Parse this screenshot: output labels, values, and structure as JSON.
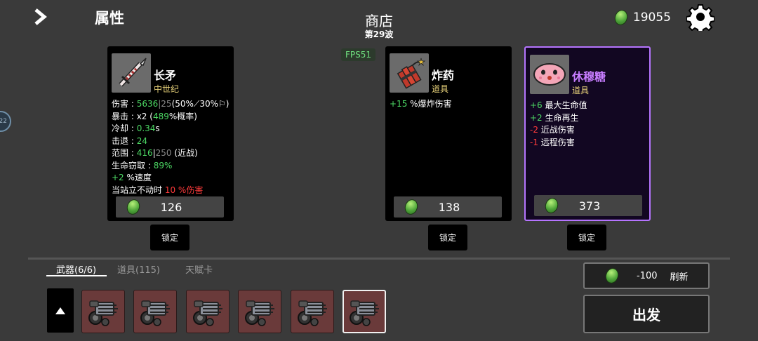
{
  "header": {
    "page_heading": "属性",
    "shop_title": "商店",
    "wave": "第29波",
    "currency_amount": "19055",
    "fps": "FPS51"
  },
  "cards": [
    {
      "name": "长矛",
      "type": "中世纪",
      "name_color": "#ffffff",
      "stats": {
        "damage_label": "伤害 : ",
        "damage_val": "5636",
        "damage_base": "25",
        "damage_scaling": "(50%⟋30%⚐)",
        "crit_label": "暴击 : ",
        "crit_mult": "x2",
        "crit_open": " (",
        "crit_chance": "489",
        "crit_suffix": "%概率)",
        "cooldown_label": "冷却 : ",
        "cooldown_val": "0.34",
        "cooldown_unit": "s",
        "knockback_label": "击退 : ",
        "knockback_val": "24",
        "range_label": "范围 : ",
        "range_val": "416",
        "range_base": "250",
        "range_type": " (近战)",
        "lifesteal_label": "生命窃取 : ",
        "lifesteal_val": "89%",
        "speed_val": "+2",
        "speed_label": " %速度",
        "standstill_label": "当站立不动时 ",
        "standstill_val": "10 %伤害"
      },
      "price": "126",
      "lock_label": "锁定"
    },
    {
      "name": "炸药",
      "type": "道具",
      "name_color": "#ffffff",
      "effects": [
        {
          "val": "+15",
          "text": " %爆炸伤害",
          "positive": true
        }
      ],
      "price": "138",
      "lock_label": "锁定"
    },
    {
      "name": "休穆糖",
      "type": "道具",
      "name_color": "#c77dff",
      "effects": [
        {
          "val": "+6",
          "text": " 最大生命值",
          "positive": true
        },
        {
          "val": "+2",
          "text": " 生命再生",
          "positive": true
        },
        {
          "val": "-2",
          "text": " 近战伤害",
          "positive": false
        },
        {
          "val": "-1",
          "text": " 远程伤害",
          "positive": false
        }
      ],
      "price": "373",
      "lock_label": "锁定"
    }
  ],
  "tabs": {
    "weapons": "武器(6/6)",
    "items": "道具(115)",
    "talents": "天赋卡"
  },
  "inventory": {
    "slot_icon": "minigun-icon",
    "slot_count": 6,
    "selected_slot": 6
  },
  "actions": {
    "refresh_cost": "-100",
    "refresh_label": "刷新",
    "depart_label": "出发"
  },
  "colors": {
    "positive": "#4cd964",
    "negative": "#ff3b3b",
    "rarity_purple": "#b574ff",
    "background": "#3a3a3a"
  }
}
